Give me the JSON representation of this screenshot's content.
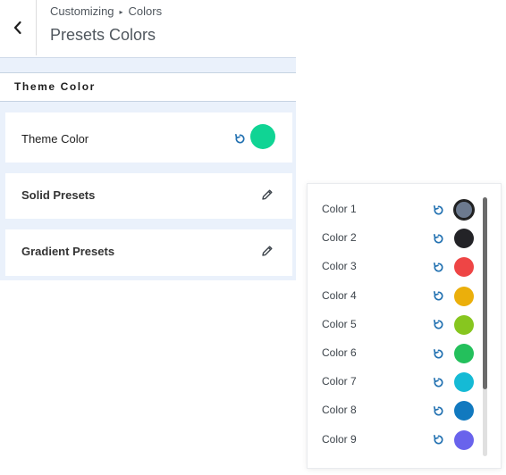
{
  "header": {
    "breadcrumb_parent": "Customizing",
    "breadcrumb_separator": "▸",
    "breadcrumb_current": "Colors",
    "title": "Presets Colors"
  },
  "section": {
    "heading": "Theme Color"
  },
  "theme_color": {
    "label": "Theme Color",
    "value": "#10d494"
  },
  "solid_presets": {
    "label": "Solid Presets"
  },
  "gradient_presets": {
    "label": "Gradient Presets"
  },
  "presets_popover": {
    "colors": [
      {
        "label": "Color 1",
        "value": "#6c7a8f",
        "selected": true
      },
      {
        "label": "Color 2",
        "value": "#232327"
      },
      {
        "label": "Color 3",
        "value": "#ee4545"
      },
      {
        "label": "Color 4",
        "value": "#ebaf0b"
      },
      {
        "label": "Color 5",
        "value": "#87c61f"
      },
      {
        "label": "Color 6",
        "value": "#24c05c"
      },
      {
        "label": "Color 7",
        "value": "#15bad5"
      },
      {
        "label": "Color 8",
        "value": "#1179bf"
      },
      {
        "label": "Color 9",
        "value": "#6963ec"
      }
    ],
    "scroll_position": 0,
    "scroll_visible_fraction": 0.74
  },
  "icons": {
    "back": "chevron-left-icon",
    "reset": "reset-icon",
    "edit": "pencil-icon"
  },
  "colors": {
    "accent": "#2271b1",
    "panel_bg": "#eaf1fb"
  }
}
